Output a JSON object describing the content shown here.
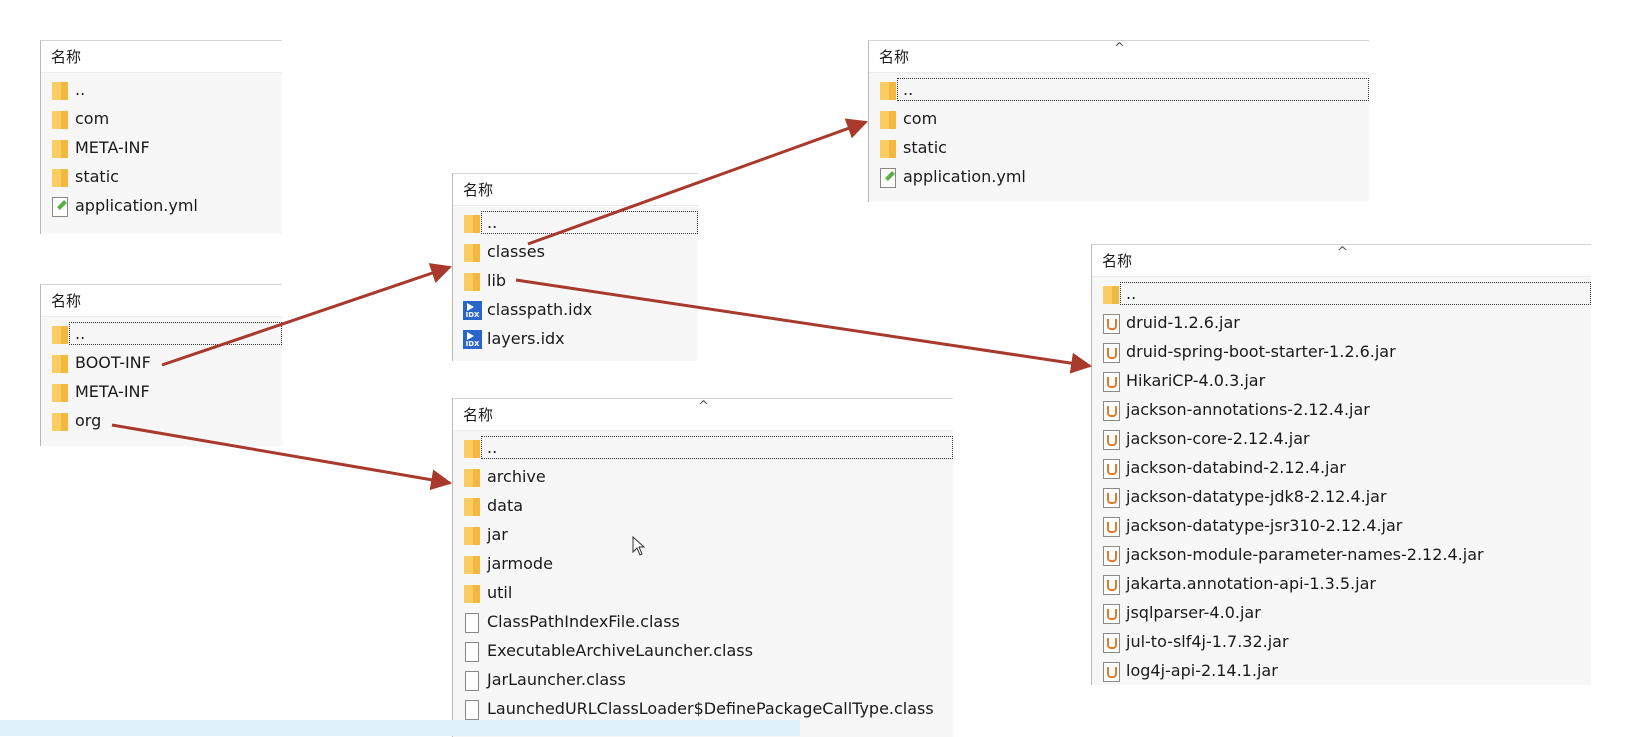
{
  "header_label": "名称",
  "panels": {
    "classes_a": {
      "items": [
        {
          "name": "..",
          "icon": "folder-icon"
        },
        {
          "name": "com",
          "icon": "folder-icon"
        },
        {
          "name": "META-INF",
          "icon": "folder-icon"
        },
        {
          "name": "static",
          "icon": "folder-icon"
        },
        {
          "name": "application.yml",
          "icon": "yml-file-icon"
        }
      ]
    },
    "root": {
      "items": [
        {
          "name": "..",
          "icon": "folder-icon"
        },
        {
          "name": "BOOT-INF",
          "icon": "folder-icon"
        },
        {
          "name": "META-INF",
          "icon": "folder-icon"
        },
        {
          "name": "org",
          "icon": "folder-icon"
        }
      ]
    },
    "boot_inf": {
      "items": [
        {
          "name": "..",
          "icon": "folder-icon"
        },
        {
          "name": "classes",
          "icon": "folder-icon"
        },
        {
          "name": "lib",
          "icon": "folder-icon"
        },
        {
          "name": "classpath.idx",
          "icon": "idx-file-icon"
        },
        {
          "name": "layers.idx",
          "icon": "idx-file-icon"
        }
      ]
    },
    "classes_b": {
      "items": [
        {
          "name": "..",
          "icon": "folder-icon"
        },
        {
          "name": "com",
          "icon": "folder-icon"
        },
        {
          "name": "static",
          "icon": "folder-icon"
        },
        {
          "name": "application.yml",
          "icon": "yml-file-icon"
        }
      ]
    },
    "org": {
      "items": [
        {
          "name": "..",
          "icon": "folder-icon"
        },
        {
          "name": "archive",
          "icon": "folder-icon"
        },
        {
          "name": "data",
          "icon": "folder-icon"
        },
        {
          "name": "jar",
          "icon": "folder-icon"
        },
        {
          "name": "jarmode",
          "icon": "folder-icon"
        },
        {
          "name": "util",
          "icon": "folder-icon"
        },
        {
          "name": "ClassPathIndexFile.class",
          "icon": "class-file-icon"
        },
        {
          "name": "ExecutableArchiveLauncher.class",
          "icon": "class-file-icon"
        },
        {
          "name": "JarLauncher.class",
          "icon": "class-file-icon"
        },
        {
          "name": "LaunchedURLClassLoader$DefinePackageCallType.class",
          "icon": "class-file-icon"
        }
      ]
    },
    "lib": {
      "items": [
        {
          "name": "..",
          "icon": "folder-icon"
        },
        {
          "name": "druid-1.2.6.jar",
          "icon": "jar-file-icon"
        },
        {
          "name": "druid-spring-boot-starter-1.2.6.jar",
          "icon": "jar-file-icon"
        },
        {
          "name": "HikariCP-4.0.3.jar",
          "icon": "jar-file-icon"
        },
        {
          "name": "jackson-annotations-2.12.4.jar",
          "icon": "jar-file-icon"
        },
        {
          "name": "jackson-core-2.12.4.jar",
          "icon": "jar-file-icon"
        },
        {
          "name": "jackson-databind-2.12.4.jar",
          "icon": "jar-file-icon"
        },
        {
          "name": "jackson-datatype-jdk8-2.12.4.jar",
          "icon": "jar-file-icon"
        },
        {
          "name": "jackson-datatype-jsr310-2.12.4.jar",
          "icon": "jar-file-icon"
        },
        {
          "name": "jackson-module-parameter-names-2.12.4.jar",
          "icon": "jar-file-icon"
        },
        {
          "name": "jakarta.annotation-api-1.3.5.jar",
          "icon": "jar-file-icon"
        },
        {
          "name": "jsqlparser-4.0.jar",
          "icon": "jar-file-icon"
        },
        {
          "name": "jul-to-slf4j-1.7.32.jar",
          "icon": "jar-file-icon"
        },
        {
          "name": "log4j-api-2.14.1.jar",
          "icon": "jar-file-icon"
        }
      ]
    }
  },
  "colors": {
    "arrow": "#a8392c",
    "folder": "#f9cd63",
    "panel_bg": "#f7f7f7"
  }
}
